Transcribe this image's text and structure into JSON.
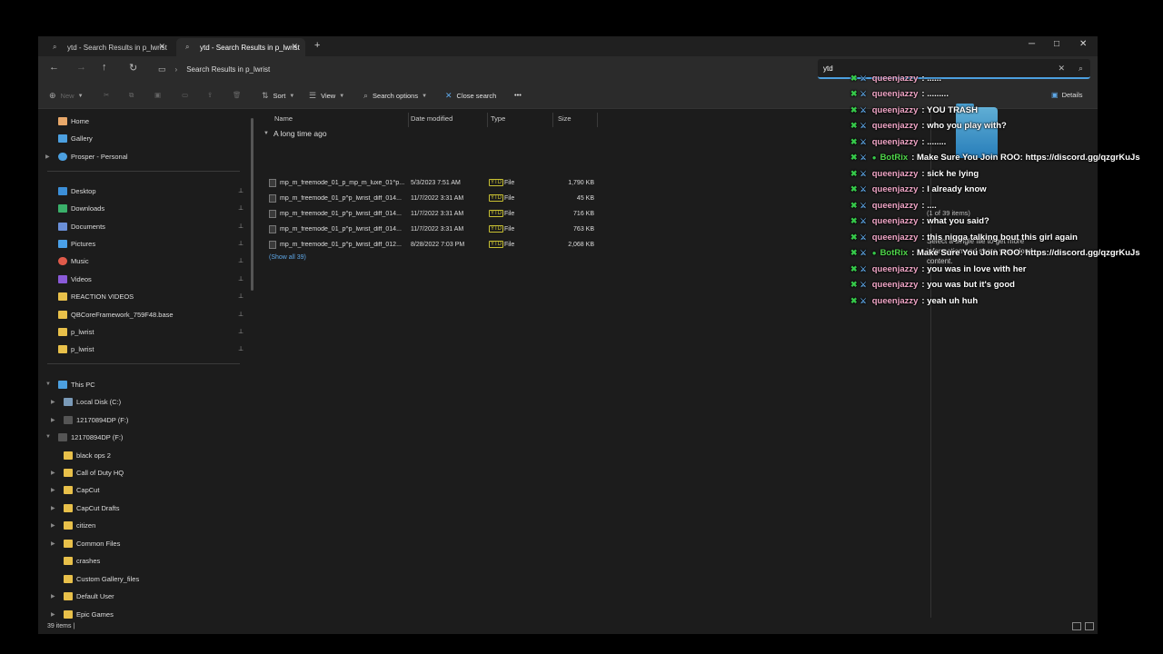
{
  "window": {
    "tabs": [
      {
        "label": "ytd - Search Results in p_lwrist",
        "active": false
      },
      {
        "label": "ytd - Search Results in p_lwrist",
        "active": true
      }
    ],
    "new_tab": "+",
    "controls": {
      "minimize": "─",
      "maximize": "□",
      "close": "✕"
    }
  },
  "address": {
    "back": "←",
    "forward": "→",
    "up": "↑",
    "refresh": "↻",
    "pc_icon": "▭",
    "sep": "›",
    "path": "Search Results in p_lwrist",
    "search_value": "ytd",
    "search_clear": "✕",
    "search_icon": "⌕"
  },
  "commands": {
    "new": "New",
    "sort": "Sort",
    "view": "View",
    "search_options": "Search options",
    "close_search": "Close search",
    "more": "•••",
    "details": "Details"
  },
  "sidebar": {
    "top": [
      {
        "label": "Home",
        "color": "#e8a86a"
      },
      {
        "label": "Gallery",
        "color": "#4ca0e0"
      },
      {
        "label": "Prosper - Personal",
        "color": "#4ca0e0"
      }
    ],
    "quick": [
      {
        "label": "Desktop",
        "color": "#3c8fd8"
      },
      {
        "label": "Downloads",
        "color": "#3ab06a"
      },
      {
        "label": "Documents",
        "color": "#6a8fd8"
      },
      {
        "label": "Pictures",
        "color": "#4aa0e8"
      },
      {
        "label": "Music",
        "color": "#e05a4a"
      },
      {
        "label": "Videos",
        "color": "#8a5ad8"
      },
      {
        "label": "REACTION VIDEOS",
        "color": "#e8c04a"
      },
      {
        "label": "QBCoreFramework_759F48.base",
        "color": "#e8c04a"
      },
      {
        "label": "p_lwrist",
        "color": "#e8c04a"
      },
      {
        "label": "p_lwrist",
        "color": "#e8c04a"
      }
    ],
    "pin": "📌",
    "this_pc": "This PC",
    "drives": [
      {
        "label": "Local Disk (C:)"
      },
      {
        "label": "12170894DP (F:)"
      },
      {
        "label": "12170894DP (F:)"
      }
    ],
    "folders": [
      {
        "label": "black ops 2"
      },
      {
        "label": "Call of Duty HQ"
      },
      {
        "label": "CapCut"
      },
      {
        "label": "CapCut Drafts"
      },
      {
        "label": "citizen"
      },
      {
        "label": "Common Files"
      },
      {
        "label": "crashes"
      },
      {
        "label": "Custom Gallery_files"
      },
      {
        "label": "Default User"
      },
      {
        "label": "Epic Games"
      }
    ]
  },
  "columns": {
    "name": "Name",
    "date": "Date modified",
    "type": "Type",
    "size": "Size"
  },
  "group_label": "A long time ago",
  "files": [
    {
      "name": "mp_m_freemode_01_p_mp_m_luxe_01^p...",
      "date": "5/3/2023 7:51 AM",
      "tag": "YTD",
      "type": "File",
      "size": "1,790 KB"
    },
    {
      "name": "mp_m_freemode_01_p^p_lwrist_diff_014...",
      "date": "11/7/2022 3:31 AM",
      "tag": "YTD",
      "type": "File",
      "size": "45 KB"
    },
    {
      "name": "mp_m_freemode_01_p^p_lwrist_diff_014...",
      "date": "11/7/2022 3:31 AM",
      "tag": "YTD",
      "type": "File",
      "size": "716 KB"
    },
    {
      "name": "mp_m_freemode_01_p^p_lwrist_diff_014...",
      "date": "11/7/2022 3:31 AM",
      "tag": "YTD",
      "type": "File",
      "size": "763 KB"
    },
    {
      "name": "mp_m_freemode_01_p^p_lwrist_diff_012...",
      "date": "8/28/2022 7:03 PM",
      "tag": "YTD",
      "type": "File",
      "size": "2,068 KB"
    }
  ],
  "show_all": "(Show all 39)",
  "details_pane": {
    "hint": "(1 of 39 items)",
    "text": "Select a single file to get more information and share your cloud content."
  },
  "status": {
    "count": "39 items",
    "sep": "|"
  },
  "chat": [
    {
      "user": "queenjazzy",
      "msg": ": ......",
      "bot": false
    },
    {
      "user": "queenjazzy",
      "msg": ": .........",
      "bot": false
    },
    {
      "user": "queenjazzy",
      "msg": ": YOU TRASH",
      "bot": false
    },
    {
      "user": "queenjazzy",
      "msg": ": who you play with?",
      "bot": false
    },
    {
      "user": "queenjazzy",
      "msg": ": ........",
      "bot": false
    },
    {
      "user": "BotRix",
      "msg": ": Make Sure You Join ROO: https://discord.gg/qzgrKuJs",
      "bot": true
    },
    {
      "user": "queenjazzy",
      "msg": ": sick he lying",
      "bot": false
    },
    {
      "user": "queenjazzy",
      "msg": ": I already know",
      "bot": false
    },
    {
      "user": "queenjazzy",
      "msg": ": ....",
      "bot": false
    },
    {
      "user": "queenjazzy",
      "msg": ": what you said?",
      "bot": false
    },
    {
      "user": "queenjazzy",
      "msg": ": this nigga talking bout this girl again",
      "bot": false
    },
    {
      "user": "BotRix",
      "msg": ": Make Sure You Join ROO: https://discord.gg/qzgrKuJs",
      "bot": true
    },
    {
      "user": "queenjazzy",
      "msg": ": you was in love with her",
      "bot": false
    },
    {
      "user": "queenjazzy",
      "msg": ": you was but it's good",
      "bot": false
    },
    {
      "user": "queenjazzy",
      "msg": ": yeah uh huh",
      "bot": false
    }
  ]
}
